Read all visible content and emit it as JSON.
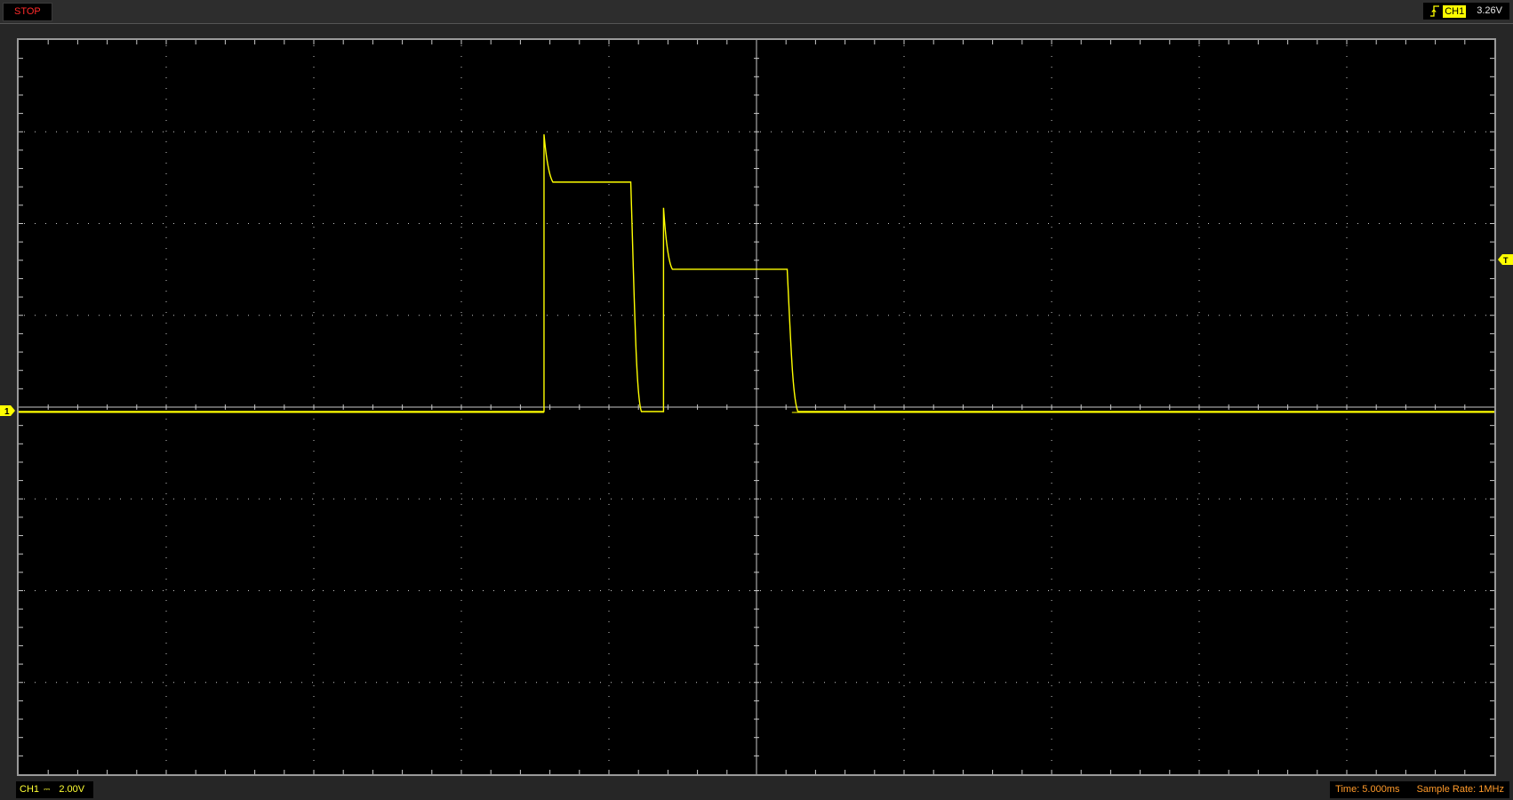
{
  "status": {
    "run_state": "STOP"
  },
  "trigger": {
    "channel": "CH1",
    "level": "3.26V",
    "edge": "rising-edge-icon"
  },
  "markers": {
    "channel_marker": "1",
    "trigger_marker": "T"
  },
  "channel": {
    "label": "CH1",
    "coupling": "DC",
    "scale": "2.00V"
  },
  "timebase": {
    "time": "Time: 5.000ms",
    "sample_rate": "Sample Rate: 1MHz"
  },
  "colors": {
    "trace": "#ffff00",
    "grid": "#c8c8c8",
    "status": "#ff2a2a",
    "time_info": "#ff9a2a",
    "background": "#000000"
  },
  "waveform": {
    "baseline_div": 0,
    "pulses": [
      {
        "rise_time_div": -1.44,
        "overshoot_div": 3.02,
        "plateau_div": 2.5,
        "fall_time_div": -0.84
      },
      {
        "rise_time_div": -0.63,
        "overshoot_div": 2.22,
        "plateau_div": 1.55,
        "fall_time_div": 0.22
      }
    ]
  }
}
